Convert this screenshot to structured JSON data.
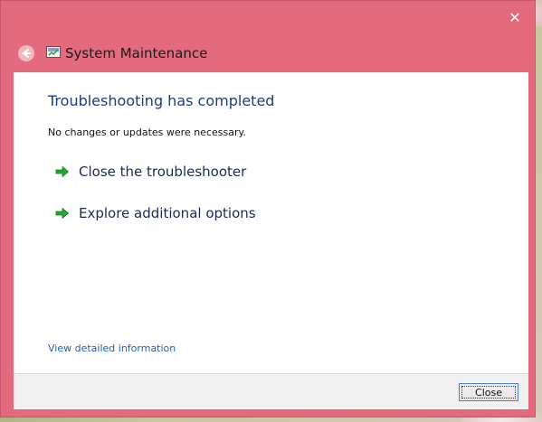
{
  "window": {
    "title": "System Maintenance",
    "close_glyph": "✕"
  },
  "main": {
    "heading": "Troubleshooting has completed",
    "message": "No changes or updates were necessary.",
    "links": [
      {
        "label": "Close the troubleshooter",
        "icon": "green-arrow-icon"
      },
      {
        "label": "Explore additional options",
        "icon": "green-arrow-icon"
      }
    ],
    "detail_link": "View detailed information"
  },
  "footer": {
    "close_label": "Close"
  },
  "colors": {
    "frame": "#e46a7e",
    "heading": "#1f3c7d",
    "link": "#1f5fb0",
    "arrow": "#22a832"
  }
}
